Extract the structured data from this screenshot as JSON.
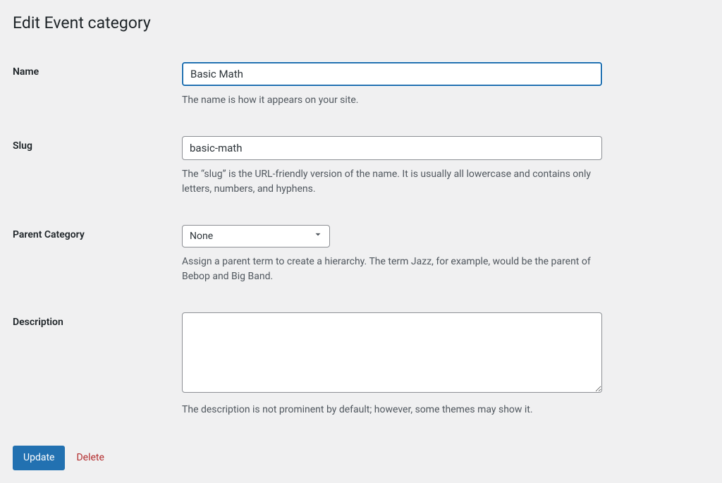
{
  "page": {
    "title": "Edit Event category"
  },
  "fields": {
    "name": {
      "label": "Name",
      "value": "Basic Math",
      "description": "The name is how it appears on your site."
    },
    "slug": {
      "label": "Slug",
      "value": "basic-math",
      "description": "The “slug” is the URL-friendly version of the name. It is usually all lowercase and contains only letters, numbers, and hyphens."
    },
    "parent": {
      "label": "Parent Category",
      "value": "None",
      "description": "Assign a parent term to create a hierarchy. The term Jazz, for example, would be the parent of Bebop and Big Band."
    },
    "description": {
      "label": "Description",
      "value": "",
      "description": "The description is not prominent by default; however, some themes may show it."
    }
  },
  "actions": {
    "update_label": "Update",
    "delete_label": "Delete"
  }
}
